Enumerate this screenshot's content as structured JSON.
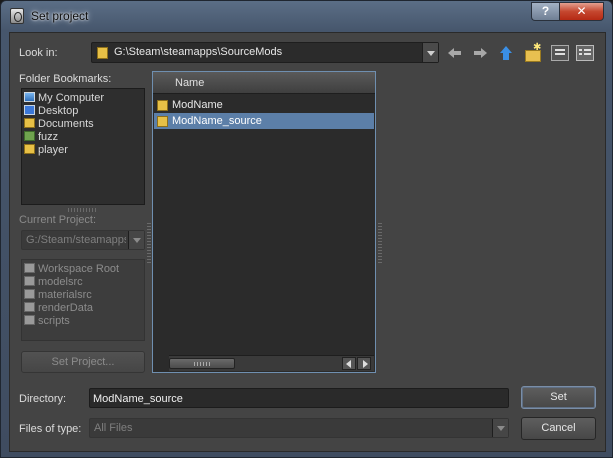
{
  "window": {
    "title": "Set project",
    "help_label": "?",
    "close_label": "✕"
  },
  "look_in": {
    "label": "Look in:",
    "value": "G:\\Steam\\steamapps\\SourceMods"
  },
  "bookmarks": {
    "label": "Folder Bookmarks:",
    "items": [
      {
        "label": "My Computer",
        "icon": "computer-icon"
      },
      {
        "label": "Desktop",
        "icon": "desktop-icon"
      },
      {
        "label": "Documents",
        "icon": "folder-icon"
      },
      {
        "label": "fuzz",
        "icon": "file-icon"
      },
      {
        "label": "player",
        "icon": "folder-icon"
      }
    ]
  },
  "current_project": {
    "label": "Current Project:",
    "value": "G:/Steam/steamapps",
    "items": [
      {
        "label": "Workspace Root"
      },
      {
        "label": "modelsrc"
      },
      {
        "label": "materialsrc"
      },
      {
        "label": "renderData"
      },
      {
        "label": "scripts"
      }
    ],
    "set_button": "Set Project..."
  },
  "file_list": {
    "column_name": "Name",
    "items": [
      {
        "label": "ModName",
        "selected": false
      },
      {
        "label": "ModName_source",
        "selected": true
      }
    ]
  },
  "directory": {
    "label": "Directory:",
    "value": "ModName_source"
  },
  "files_of_type": {
    "label": "Files of type:",
    "value": "All Files"
  },
  "buttons": {
    "set": "Set",
    "cancel": "Cancel"
  },
  "colors": {
    "selection": "#5c7fa8",
    "background": "#444444",
    "title_bar": "#4f5f76"
  }
}
